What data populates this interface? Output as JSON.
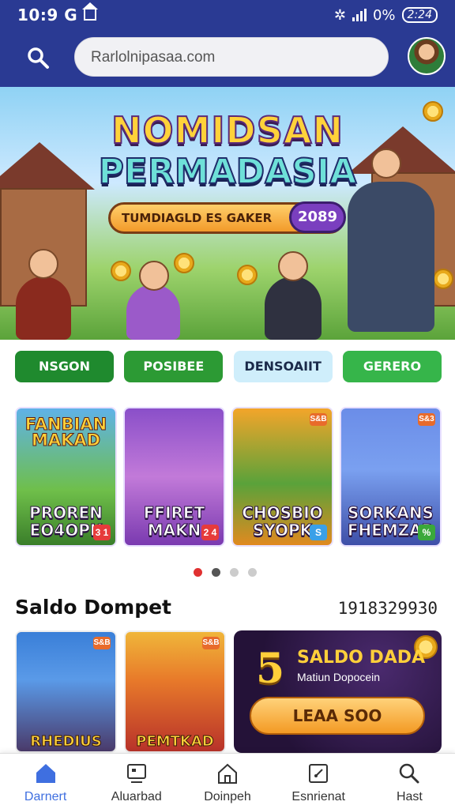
{
  "status_bar": {
    "time": "10:9 G",
    "battery_text": "0%",
    "clock_badge": "2:24"
  },
  "search": {
    "value": "Rarlolnipasaa.com"
  },
  "banner": {
    "title_line1": "NOMIDSAN",
    "title_line2": "PERMADASIA",
    "subtitle": "TUMDIAGLD ES GAKER",
    "subtitle_number": "2089"
  },
  "chips": [
    {
      "label": "NSGON",
      "bg": "#1f8a2e",
      "fg": "#ffffff"
    },
    {
      "label": "POSIBEE",
      "bg": "#2c9a34",
      "fg": "#ffffff"
    },
    {
      "label": "DENSOAIIT",
      "bg": "#cfeefb",
      "fg": "#1b2a4a"
    },
    {
      "label": "GERERO",
      "bg": "#36b54a",
      "fg": "#ffffff"
    }
  ],
  "game_cards": [
    {
      "top": "FANBIAN MAKAD",
      "label": "PROREN EO4OPK",
      "badge": "3 1",
      "badge_top": ""
    },
    {
      "top": "",
      "label": "FFIRET MAKN",
      "badge": "2 4",
      "badge_top": ""
    },
    {
      "top": "",
      "label": "CHOSBIO SYOPK",
      "badge": "S",
      "badge_top": "S&B"
    },
    {
      "top": "",
      "label": "SORKANS FHEMZAR",
      "badge": "%",
      "badge_top": "S&3"
    }
  ],
  "carousel": {
    "dot_colors": [
      "#e03131",
      "#555555",
      "#cccccc",
      "#cccccc"
    ]
  },
  "wallet_section": {
    "title": "Saldo Dompet",
    "number": "1918329930"
  },
  "wallet_cards": [
    {
      "label": "RHEDIUS",
      "badge": "S&B"
    },
    {
      "label": "PEMTKAD",
      "badge": "S&B"
    }
  ],
  "promo": {
    "big": "5",
    "title": "SALDO DADA",
    "subtitle": "Matiun Dopocein",
    "button": "LEAA SOO"
  },
  "bottom_nav": [
    {
      "label": "Darnert",
      "icon": "home-icon",
      "active": true
    },
    {
      "label": "Aluarbad",
      "icon": "tv-icon",
      "active": false
    },
    {
      "label": "Doinpeh",
      "icon": "house-outline-icon",
      "active": false
    },
    {
      "label": "Esnrienat",
      "icon": "edit-icon",
      "active": false
    },
    {
      "label": "Hast",
      "icon": "search-icon",
      "active": false
    }
  ],
  "colors": {
    "header_bg": "#2a3a93",
    "accent": "#3f6fe0"
  }
}
